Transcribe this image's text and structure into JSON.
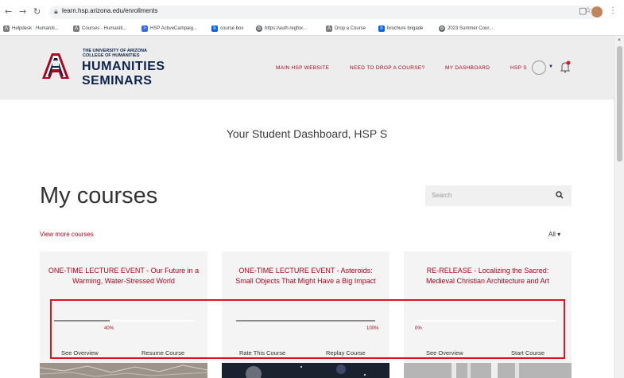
{
  "browser": {
    "url": "learn.hsp.arizona.edu/enrollments",
    "back_icon": "arrow-left-icon",
    "forward_icon": "arrow-right-icon",
    "reload_icon": "reload-icon"
  },
  "bookmarks": [
    {
      "label": "Helpdesk : Humaniti...",
      "color": "#5f6368"
    },
    {
      "label": "Courses - Humaniti...",
      "color": "#5f6368"
    },
    {
      "label": "HSP ActiveCampaig...",
      "color": "#356ae6"
    },
    {
      "label": "course box",
      "color": "#0061fe"
    },
    {
      "label": "https://auth.regfox...",
      "color": "#5f6368"
    },
    {
      "label": "Drop a Course",
      "color": "#5f6368"
    },
    {
      "label": "brochure brigade",
      "color": "#0061fe"
    },
    {
      "label": "2023 Summer Cour...",
      "color": "#5f6368"
    }
  ],
  "header": {
    "logo_line1": "THE UNIVERSITY OF ARIZONA",
    "logo_line2": "COLLEGE OF HUMANITIES",
    "logo_big1": "HUMANITIES",
    "logo_big2": "SEMINARS",
    "nav": [
      "MAIN HSP WEBSITE",
      "NEED TO DROP A COURSE?",
      "MY DASHBOARD"
    ],
    "user_label": "HSP S",
    "brand_red": "#ab0520",
    "brand_navy": "#0c234b"
  },
  "main": {
    "dashboard_title": "Your Student Dashboard, HSP S",
    "heading": "My courses",
    "search_placeholder": "Search",
    "view_more": "View more courses",
    "filter_label": "All"
  },
  "courses": [
    {
      "title": "ONE-TIME LECTURE EVENT - Our Future in a Warming, Water-Stressed World",
      "progress": 40,
      "progress_label": "40%",
      "action_left": "See Overview",
      "action_right": "Resume Course"
    },
    {
      "title": "ONE-TIME LECTURE EVENT - Asteroids: Small Objects That Might Have a Big Impact",
      "progress": 100,
      "progress_label": "100%",
      "action_left": "Rate This Course",
      "action_right": "Replay Course"
    },
    {
      "title": "RE-RELEASE - Localizing the Sacred: Medieval Christian Architecture and Art",
      "progress": 0,
      "progress_label": "0%",
      "action_left": "See Overview",
      "action_right": "Start Course"
    }
  ]
}
